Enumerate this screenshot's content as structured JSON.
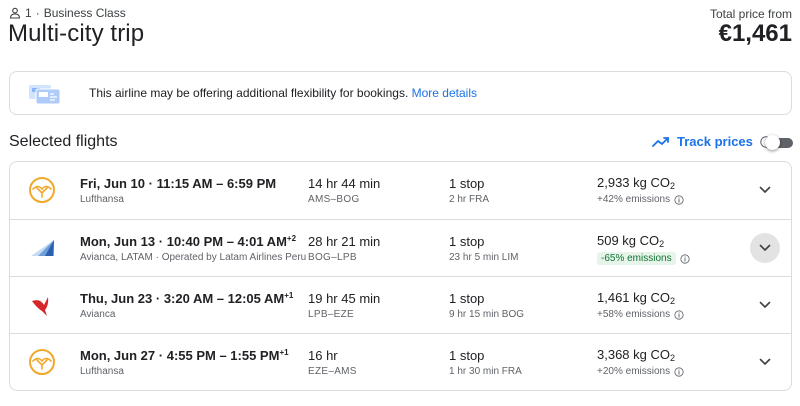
{
  "header": {
    "passengers": "1",
    "separator": "·",
    "cabin": "Business Class",
    "title": "Multi-city trip",
    "total_label": "Total price from",
    "total_price": "€1,461"
  },
  "notice": {
    "text": "This airline may be offering additional flexibility for bookings.",
    "link": "More details"
  },
  "section": {
    "title": "Selected flights",
    "track_label": "Track prices",
    "track_enabled": false
  },
  "colors": {
    "accent": "#1a73e8",
    "border": "#dadce0",
    "good_emissions_bg": "#e6f4ea",
    "good_emissions_text": "#137333",
    "lufthansa": "#f0a82b",
    "avianca": "#d7262a"
  },
  "flights": [
    {
      "date": "Fri, Jun 10",
      "dot": "·",
      "times": "11:15 AM – 6:59 PM",
      "day_offset": "",
      "airline": "Lufthansa",
      "logo": "lufthansa-crane-icon",
      "duration": "14 hr 44 min",
      "route": "AMS–BOG",
      "stops": "1 stop",
      "layover": "2 hr FRA",
      "co2_value": "2,933 kg CO",
      "co2_sub": "2",
      "emissions": "+42% emissions",
      "emissions_good": false
    },
    {
      "date": "Mon, Jun 13",
      "dot": "·",
      "times": "10:40 PM – 4:01 AM",
      "day_offset": "+2",
      "airline": "Avianca, LATAM · Operated by Latam Airlines Peru",
      "logo": "latam-tail-icon",
      "duration": "28 hr 21 min",
      "route": "BOG–LPB",
      "stops": "1 stop",
      "layover": "23 hr 5 min LIM",
      "co2_value": "509 kg CO",
      "co2_sub": "2",
      "emissions": "-65% emissions",
      "emissions_good": true
    },
    {
      "date": "Thu, Jun 23",
      "dot": "·",
      "times": "3:20 AM – 12:05 AM",
      "day_offset": "+1",
      "airline": "Avianca",
      "logo": "avianca-bird-icon",
      "duration": "19 hr 45 min",
      "route": "LPB–EZE",
      "stops": "1 stop",
      "layover": "9 hr 15 min BOG",
      "co2_value": "1,461 kg CO",
      "co2_sub": "2",
      "emissions": "+58% emissions",
      "emissions_good": false
    },
    {
      "date": "Mon, Jun 27",
      "dot": "·",
      "times": "4:55 PM – 1:55 PM",
      "day_offset": "+1",
      "airline": "Lufthansa",
      "logo": "lufthansa-crane-icon",
      "duration": "16 hr",
      "route": "EZE–AMS",
      "stops": "1 stop",
      "layover": "1 hr 30 min FRA",
      "co2_value": "3,368 kg CO",
      "co2_sub": "2",
      "emissions": "+20% emissions",
      "emissions_good": false
    }
  ]
}
